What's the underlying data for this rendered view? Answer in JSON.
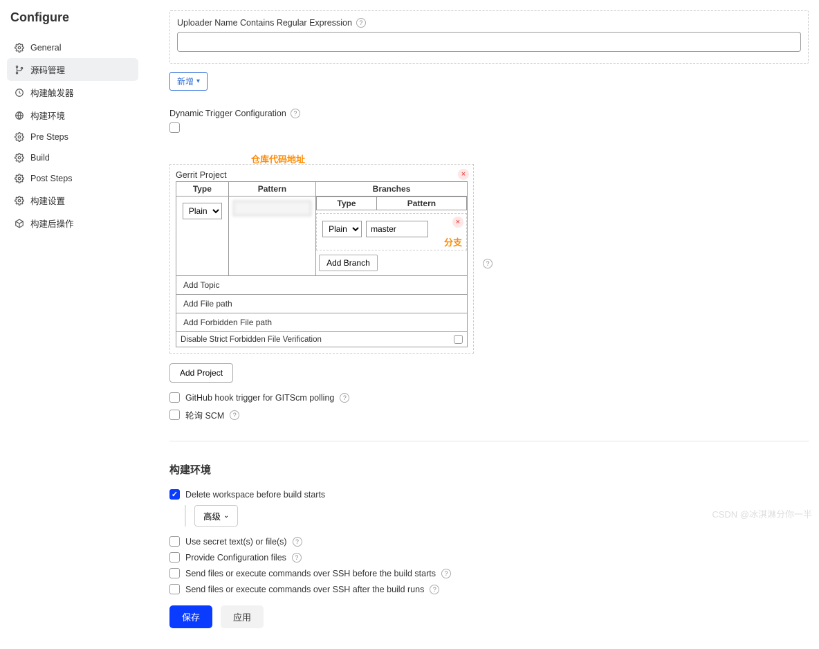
{
  "page_title": "Configure",
  "sidebar": {
    "items": [
      {
        "label": "General",
        "icon": "gear"
      },
      {
        "label": "源码管理",
        "icon": "branch"
      },
      {
        "label": "构建触发器",
        "icon": "clock"
      },
      {
        "label": "构建环境",
        "icon": "globe"
      },
      {
        "label": "Pre Steps",
        "icon": "gear"
      },
      {
        "label": "Build",
        "icon": "gear"
      },
      {
        "label": "Post Steps",
        "icon": "gear"
      },
      {
        "label": "构建设置",
        "icon": "gear"
      },
      {
        "label": "构建后操作",
        "icon": "box"
      }
    ],
    "active_index": 1
  },
  "uploader": {
    "label": "Uploader Name Contains Regular Expression",
    "value": "",
    "add_btn": "新增"
  },
  "dyn_trigger": {
    "label": "Dynamic Trigger Configuration",
    "checked": false
  },
  "annotations": {
    "repo_addr": "仓库代码地址",
    "branch": "分支"
  },
  "gerrit": {
    "title": "Gerrit Project",
    "headers": {
      "type": "Type",
      "pattern": "Pattern",
      "branches": "Branches"
    },
    "inner_headers": {
      "type": "Type",
      "pattern": "Pattern"
    },
    "type_select": "Plain",
    "branch": {
      "type_select": "Plain",
      "pattern": "master"
    },
    "add_branch": "Add Branch",
    "rows": [
      "Add Topic",
      "Add File path",
      "Add Forbidden File path"
    ],
    "disable_strict": {
      "label": "Disable Strict Forbidden File Verification",
      "checked": false
    },
    "add_project": "Add Project"
  },
  "triggers": {
    "github_hook": {
      "label": "GitHub hook trigger for GITScm polling",
      "checked": false
    },
    "poll_scm": {
      "label": "轮询 SCM",
      "checked": false
    }
  },
  "build_env": {
    "title": "构建环境",
    "delete_ws": {
      "label": "Delete workspace before build starts",
      "checked": true
    },
    "advanced": "高级",
    "use_secret": {
      "label": "Use secret text(s) or file(s)",
      "checked": false
    },
    "provide_config": {
      "label": "Provide Configuration files",
      "checked": false
    },
    "ssh_before": {
      "label": "Send files or execute commands over SSH before the build starts",
      "checked": false
    },
    "ssh_after": {
      "label": "Send files or execute commands over SSH after the build runs",
      "checked": false
    }
  },
  "footer": {
    "save": "保存",
    "apply": "应用"
  },
  "watermark": "CSDN @冰淇淋分你一半"
}
